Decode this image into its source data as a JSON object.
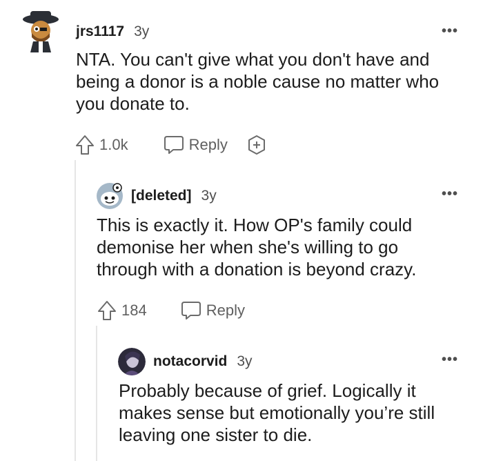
{
  "comments": [
    {
      "author": "jrs1117",
      "age": "3y",
      "text": "NTA. You can't give what you don't have and being a donor is a noble cause no matter who you donate to.",
      "votes": "1.0k",
      "reply_label": "Reply",
      "more_label": "•••"
    },
    {
      "author": "[deleted]",
      "age": "3y",
      "text": "This is exactly it. How OP's family could demonise her when she's willing to go through with a donation is beyond crazy.",
      "votes": "184",
      "reply_label": "Reply",
      "more_label": "•••"
    },
    {
      "author": "notacorvid",
      "age": "3y",
      "text": "Probably because of grief. Logically it makes sense but emotionally you’re still leaving one sister to die.",
      "more_label": "•••"
    }
  ],
  "icons": {
    "upvote": "upvote-arrow-icon",
    "reply": "speech-bubble-icon",
    "award": "award-plus-icon",
    "more": "more-options-icon"
  }
}
